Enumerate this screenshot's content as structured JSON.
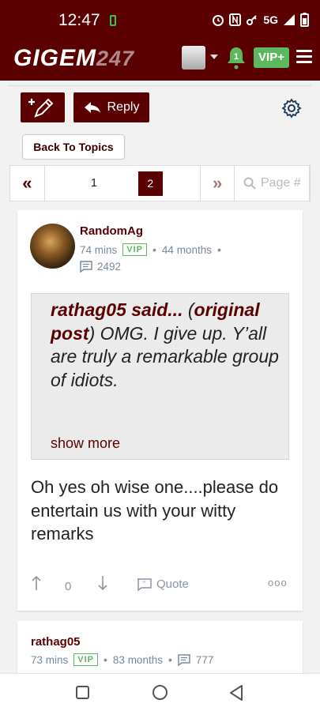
{
  "status": {
    "time": "12:47",
    "network": "5G"
  },
  "nav": {
    "logo_main": "GIGEM",
    "logo_num": "247",
    "vip_label": "VIP+",
    "notif_count": "1"
  },
  "toolbar": {
    "reply_label": "Reply"
  },
  "back_topics": "Back To Topics",
  "pager": {
    "first": "«",
    "page1": "1",
    "current": "2",
    "next": "»",
    "placeholder": "Page #"
  },
  "post1": {
    "username": "RandomAg",
    "mins": "74 mins",
    "vip": "VIP",
    "months": "44 months",
    "count": "2492",
    "quote_author": "rathag05 said...",
    "quote_link_open": "(",
    "quote_link": "original post",
    "quote_link_close": ")",
    "quote_body": " OMG. I give up. Y’all are truly a remarkable group of idiots.",
    "show_more": "show more",
    "body": "Oh yes oh wise one....please do entertain us with your witty remarks",
    "score": "0",
    "quote_label": "Quote",
    "more": "ooo"
  },
  "post2": {
    "username": "rathag05",
    "mins": "73 mins",
    "vip": "VIP",
    "months": "83 months",
    "count": "777"
  },
  "colors": {
    "brand": "#5b0000",
    "vip": "#5cb85c",
    "meta": "#7a8a9a"
  }
}
